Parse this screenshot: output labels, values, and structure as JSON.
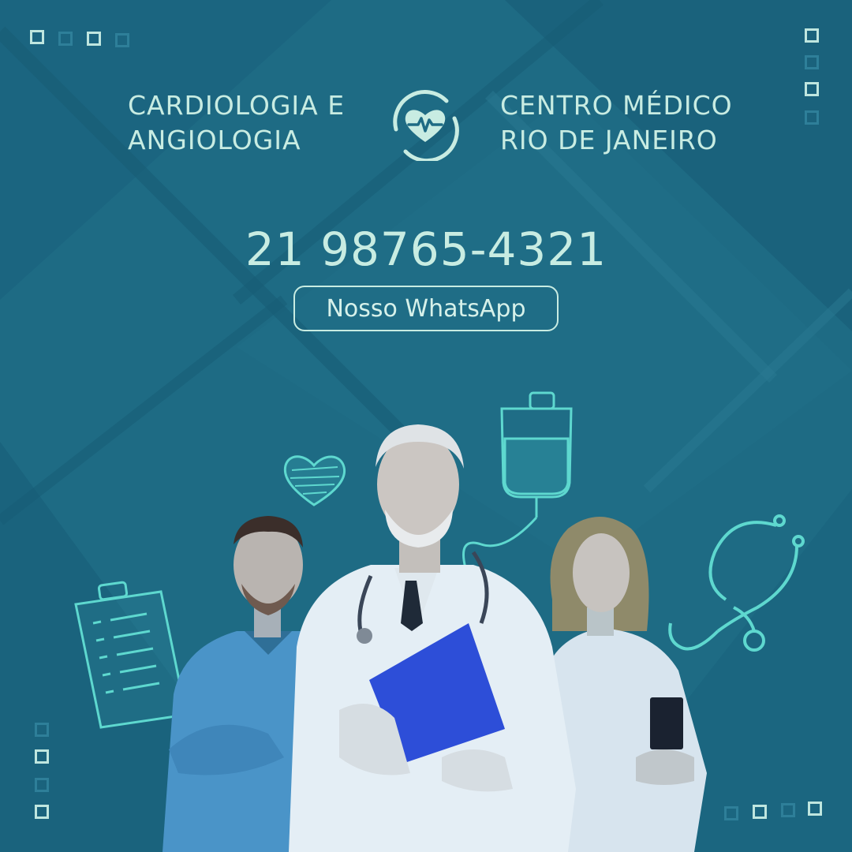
{
  "header": {
    "left_lines": [
      "CARDIOLOGIA E",
      "ANGIOLOGIA"
    ],
    "right_lines": [
      "CENTRO MÉDICO",
      "RIO DE JANEIRO"
    ],
    "logo_icon": "heart-pulse-icon"
  },
  "contact": {
    "phone": "21 98765-4321",
    "whatsapp_label": "Nosso WhatsApp"
  },
  "colors": {
    "background": "#1d6a83",
    "text_accent": "#c8ece2",
    "doodle_stroke": "#5ed8cf",
    "clipboard_blue": "#2d4ed8"
  },
  "illustrations": [
    "heart-doodle-icon",
    "iv-bag-doodle-icon",
    "stethoscope-doodle-icon",
    "clipboard-doodle-icon"
  ],
  "people": [
    "male-nurse",
    "senior-doctor",
    "female-doctor"
  ]
}
